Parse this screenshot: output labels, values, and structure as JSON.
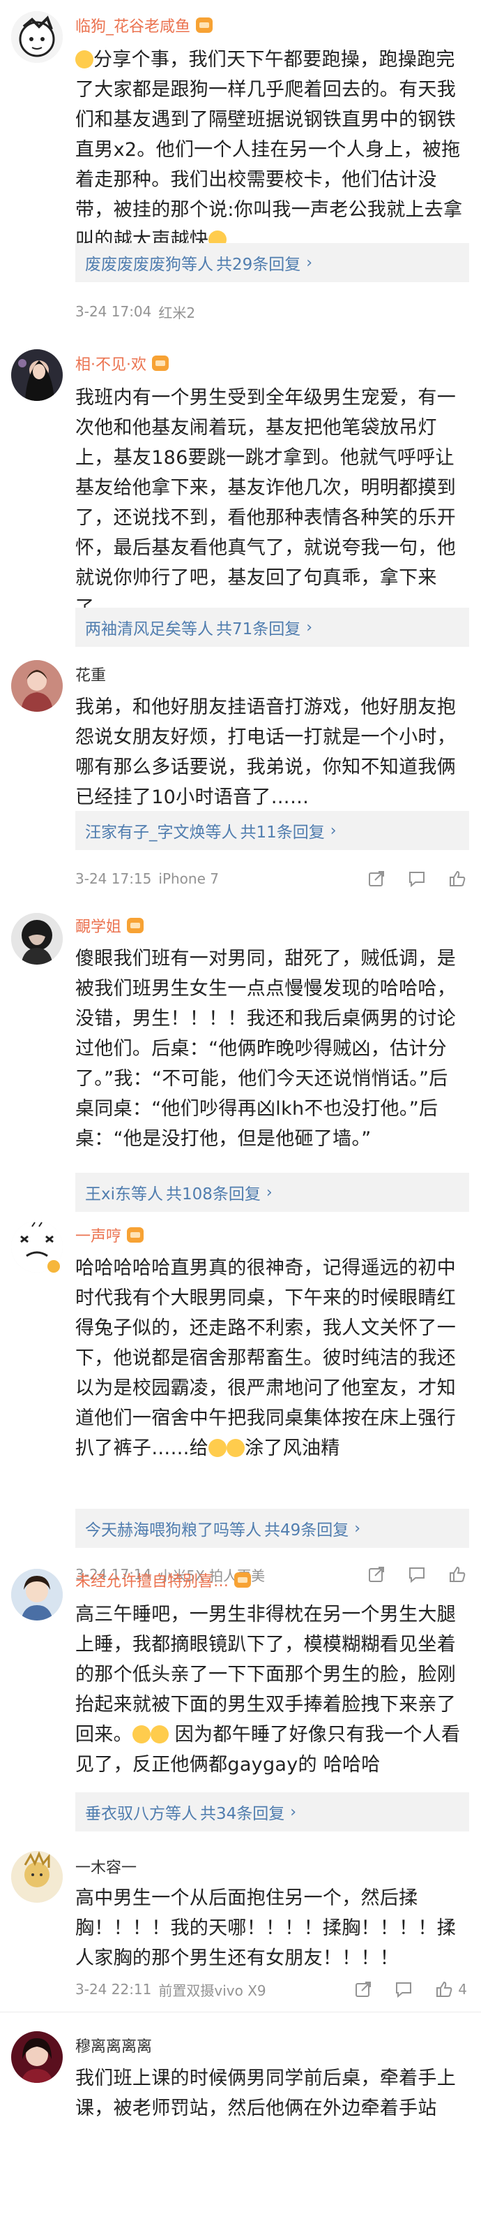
{
  "comments": [
    {
      "name": "临狗_花谷老咸鱼",
      "text": "分享个事，我们天下午都要跑操，跑操跑完了大家都是跟狗一样几乎爬着回去的。有天我们和基友遇到了隔壁班据说钢铁直男中的钢铁直男x2。他们一个人挂在另一个人身上，被拖着走那种。我们出校需要校卡，他们估计没带，被挂的那个说:你叫我一声老公我就上去拿叫的越大声越快",
      "reply_users": "废废废废废狗等人",
      "reply_count": "共29条回复",
      "time": "3-24 17:04",
      "source": "红米2",
      "likes": ""
    },
    {
      "name": "相·不见·欢",
      "text": "我班内有一个男生受到全年级男生宠爱，有一次他和他基友闹着玩，基友把他笔袋放吊灯上，基友186要跳一跳才拿到。他就气呼呼让基友给他拿下来，基友诈他几次，明明都摸到了，还说找不到，看他那种表情各种笑的乐开怀，最后基友看他真气了，就说夸我一句，他就说你帅行了吧，基友回了句真乖，拿下来了。",
      "reply_users": "两袖清风足矣等人",
      "reply_count": "共71条回复",
      "time": "",
      "source": "",
      "likes": ""
    },
    {
      "name": "花重",
      "text": "我弟，和他好朋友挂语音打游戏，他好朋友抱怨说女朋友好烦，打电话一打就是一个小时，哪有那么多话要说，我弟说，你知不知道我俩已经挂了10小时语音了……",
      "reply_users": "汪家有子_字文焕等人",
      "reply_count": "共11条回复",
      "time": "3-24 17:15",
      "source": "iPhone 7",
      "likes": ""
    },
    {
      "name": "靦学姐",
      "text": "傻眼我们班有一对男同，甜死了，贼低调，是被我们班男生女生一点点慢慢发现的哈哈哈，没错，男生！！！！我还和我后桌俩男的讨论过他们。后桌：“他俩昨晚吵得贼凶，估计分了。”我：“不可能，他们今天还说悄悄话。”后桌同桌：“他们吵得再凶lkh不也没打他。”后桌：“他是没打他，但是他砸了墙。”",
      "reply_users": "王xi东等人",
      "reply_count": "共108条回复",
      "time": "",
      "source": "",
      "likes": ""
    },
    {
      "name": "一声哼",
      "text": "哈哈哈哈哈直男真的很神奇，记得遥远的初中时代我有个大眼男同桌，下午来的时候眼睛红得兔子似的，还走路不利索，我人文关怀了一下，他说都是宿舍那帮畜生。彼时纯洁的我还以为是校园霸凌，很严肃地问了他室友，才知道他们一宿舍中午把我同桌集体按在床上强行扒了裤子……给",
      "text_tail": "涂了风油精",
      "reply_users": "今天赫海喂狗粮了吗等人",
      "reply_count": "共49条回复",
      "time": "3-24 17:14",
      "source": "小米5X 拍人更美",
      "likes": ""
    },
    {
      "name": "未经允许擅自特别喜…",
      "text": "高三午睡吧，一男生非得枕在另一个男生大腿上睡，我都摘眼镜趴下了，模模糊糊看见坐着的那个低头亲了一下下面那个男生的脸，脸刚抬起来就被下面的男生双手捧着脸拽下来亲了回来。",
      "text_tail": "因为都午睡了好像只有我一个人看见了，反正他俩都gaygay的 哈哈哈",
      "reply_users": "垂衣驭八方等人",
      "reply_count": "共34条回复",
      "time": "",
      "source": "",
      "likes": ""
    },
    {
      "name": "一木容一",
      "text": "高中男生一个从后面抱住另一个，然后揉胸！！！！我的天哪！！！！揉胸！！！！揉人家胸的那个男生还有女朋友！！！！",
      "reply_users": "",
      "reply_count": "",
      "time": "3-24 22:11",
      "source": "前置双摄vivo X9",
      "likes": "4"
    },
    {
      "name": "穆离离离离",
      "text": "我们班上课的时候俩男同学前后桌，牵着手上课，被老师罚站，然后他俩在外边牵着手站",
      "reply_users": "",
      "reply_count": "",
      "time": "",
      "source": "",
      "likes": ""
    }
  ],
  "colors": {
    "username": "#eb7350",
    "reply_link": "#507daf",
    "meta": "#939393",
    "reply_bg": "#f2f2f2"
  }
}
